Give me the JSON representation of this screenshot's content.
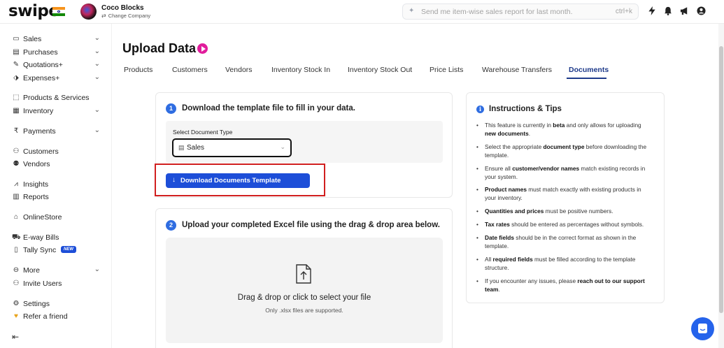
{
  "topbar": {
    "logo": "swipe",
    "company_name": "Coco Blocks",
    "change_company": "Change Company",
    "search_placeholder": "Send me item-wise sales report for last month.",
    "search_shortcut": "ctrl+k",
    "icons": [
      "bolt-icon",
      "bell-icon",
      "megaphone-icon",
      "user-icon"
    ]
  },
  "sidebar": {
    "items": [
      {
        "label": "Sales",
        "icon": "sales-icon",
        "chevron": true
      },
      {
        "label": "Purchases",
        "icon": "purchases-icon",
        "chevron": true
      },
      {
        "label": "Quotations+",
        "icon": "quotations-icon",
        "chevron": true
      },
      {
        "label": "Expenses+",
        "icon": "expenses-icon",
        "chevron": true
      },
      {
        "label": "Products & Services",
        "icon": "products-icon",
        "chevron": false
      },
      {
        "label": "Inventory",
        "icon": "inventory-icon",
        "chevron": true
      },
      {
        "label": "Payments",
        "icon": "rupee-icon",
        "chevron": true
      },
      {
        "label": "Customers",
        "icon": "customers-icon",
        "chevron": false
      },
      {
        "label": "Vendors",
        "icon": "vendors-icon",
        "chevron": false
      },
      {
        "label": "Insights",
        "icon": "insights-icon",
        "chevron": false
      },
      {
        "label": "Reports",
        "icon": "reports-icon",
        "chevron": false
      },
      {
        "label": "OnlineStore",
        "icon": "store-icon",
        "chevron": false
      },
      {
        "label": "E-way Bills",
        "icon": "truck-icon",
        "chevron": false
      },
      {
        "label": "Tally Sync",
        "icon": "tally-icon",
        "chevron": false,
        "badge": "NEW"
      },
      {
        "label": "More",
        "icon": "more-icon",
        "chevron": true
      },
      {
        "label": "Invite Users",
        "icon": "invite-icon",
        "chevron": false
      },
      {
        "label": "Settings",
        "icon": "settings-icon",
        "chevron": false
      },
      {
        "label": "Refer a friend",
        "icon": "heart-icon",
        "chevron": false
      }
    ]
  },
  "page": {
    "title": "Upload Data",
    "tabs": [
      "Products",
      "Customers",
      "Vendors",
      "Inventory Stock In",
      "Inventory Stock Out",
      "Price Lists",
      "Warehouse Transfers",
      "Documents"
    ],
    "active_tab": "Documents"
  },
  "step1": {
    "number": "1",
    "title": "Download the template file to fill in your data.",
    "select_label": "Select Document Type",
    "select_value": "Sales",
    "button": "Download Documents Template"
  },
  "step2": {
    "number": "2",
    "title": "Upload your completed Excel file using the drag & drop area below.",
    "drop_title": "Drag & drop or click to select your file",
    "drop_sub": "Only .xlsx files are supported."
  },
  "tips": {
    "title": "Instructions & Tips",
    "items": [
      "This feature is currently in <b>beta</b> and only allows for uploading <b>new documents</b>.",
      "Select the appropriate <b>document type</b> before downloading the template.",
      "Ensure all <b>customer/vendor names</b> match existing records in your system.",
      "<b>Product names</b> must match exactly with existing products in your inventory.",
      "<b>Quantities and prices</b> must be positive numbers.",
      "<b>Tax rates</b> should be entered as percentages without symbols.",
      "<b>Date fields</b> should be in the correct format as shown in the template.",
      "All <b>required fields</b> must be filled according to the template structure.",
      "If you encounter any issues, please <b>reach out to our support team</b>."
    ]
  },
  "colors": {
    "accent": "#1d4ed8",
    "active_tab": "#1e3a8a",
    "highlight": "#d11f1f",
    "play": "#e11d9c"
  }
}
